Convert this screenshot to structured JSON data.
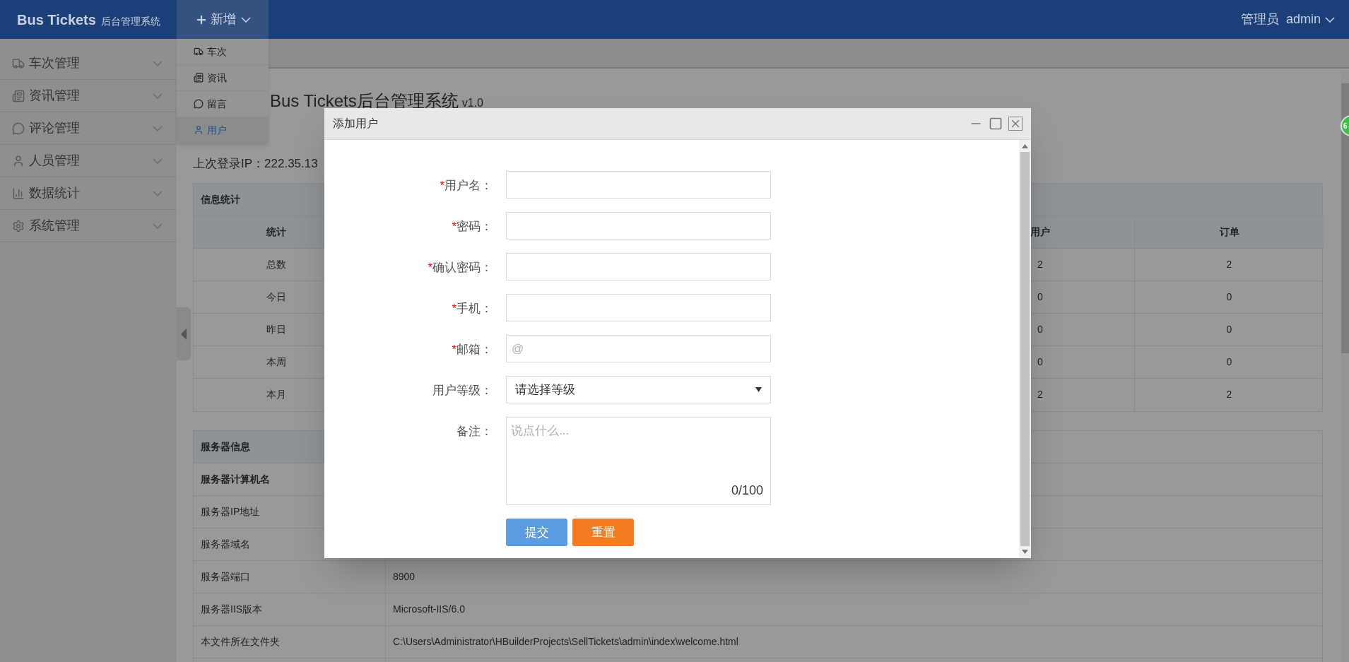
{
  "header": {
    "brand": "Bus Tickets",
    "brand_subtitle": "后台管理系统",
    "new_menu": "新增",
    "user_role": "管理员",
    "user_name": "admin"
  },
  "new_menu_items": [
    {
      "kind": "truck",
      "label": "车次",
      "selected": false
    },
    {
      "kind": "news",
      "label": "资讯",
      "selected": false
    },
    {
      "kind": "chat",
      "label": "留言",
      "selected": false
    },
    {
      "kind": "user",
      "label": "用户",
      "selected": true
    }
  ],
  "sidebar": {
    "items": [
      {
        "kind": "truck",
        "label": "车次管理"
      },
      {
        "kind": "news",
        "label": "资讯管理"
      },
      {
        "kind": "chat",
        "label": "评论管理"
      },
      {
        "kind": "user",
        "label": "人员管理"
      },
      {
        "kind": "stats",
        "label": "数据统计"
      },
      {
        "kind": "gear",
        "label": "系统管理"
      }
    ]
  },
  "page": {
    "title": "Bus Tickets后台管理系统",
    "version": "v1.0",
    "last_login": "上次登录IP：222.35.13"
  },
  "info_table": {
    "title": "信息统计",
    "columns": [
      "统计",
      "用户",
      "订单"
    ],
    "rows": [
      [
        "总数",
        "2",
        "2"
      ],
      [
        "今日",
        "0",
        "0"
      ],
      [
        "昨日",
        "0",
        "0"
      ],
      [
        "本周",
        "0",
        "0"
      ],
      [
        "本月",
        "2",
        "2"
      ]
    ]
  },
  "server_table": {
    "title": "服务器信息",
    "rows": [
      {
        "label": "服务器计算机名",
        "bold": true
      },
      {
        "label": "服务器IP地址",
        "bold": false
      },
      {
        "label": "服务器域名",
        "bold": false
      },
      {
        "label": "服务器端口",
        "bold": false,
        "value": "8900"
      },
      {
        "label": "服务器IIS版本",
        "bold": false,
        "value": "Microsoft-IIS/6.0"
      },
      {
        "label": "本文件所在文件夹",
        "bold": false,
        "value": "C:\\Users\\Administrator\\HBuilderProjects\\SellTickets\\admin\\index\\welcome.html"
      }
    ]
  },
  "dialog": {
    "title": "添加用户",
    "fields": [
      {
        "kind": "text",
        "mark": "*",
        "label": "用户名："
      },
      {
        "kind": "text",
        "mark": "*",
        "label": "密码："
      },
      {
        "kind": "text",
        "mark": "*",
        "label": "确认密码："
      },
      {
        "kind": "text",
        "mark": "*",
        "label": "手机："
      },
      {
        "kind": "text",
        "mark": "*",
        "label": "邮箱：",
        "placeholder": "@"
      },
      {
        "kind": "select",
        "label": "用户等级：",
        "value": "请选择等级"
      },
      {
        "kind": "textarea",
        "label": "备注：",
        "placeholder": "说点什么...",
        "counter": "0/100"
      }
    ],
    "buttons": [
      {
        "kind": "primary",
        "label": "提交"
      },
      {
        "kind": "warning",
        "label": "重置"
      }
    ]
  },
  "badge": "6"
}
